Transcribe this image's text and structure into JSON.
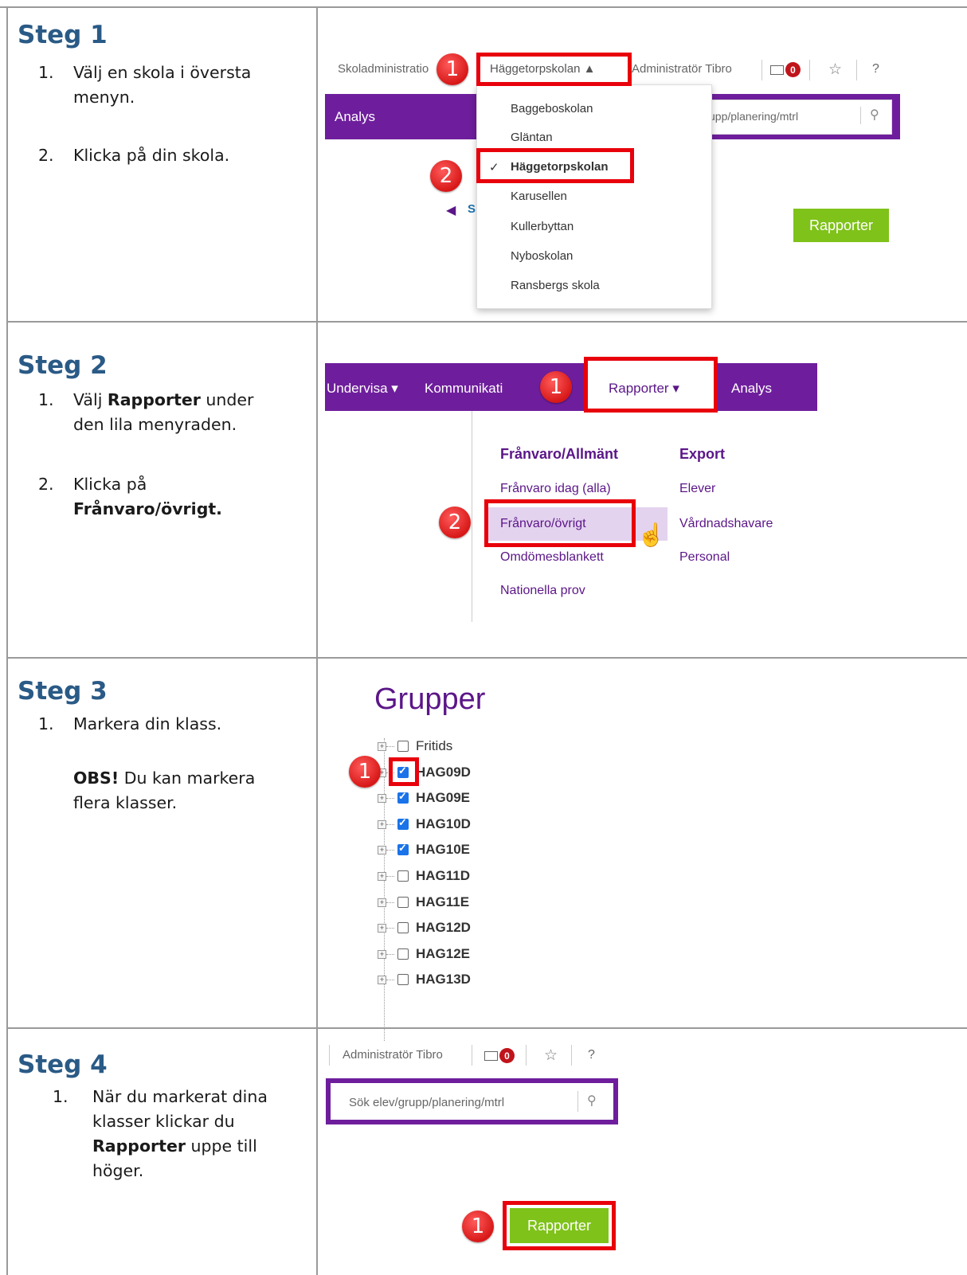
{
  "steps": [
    {
      "title": "Steg 1",
      "items": [
        {
          "n": "1.",
          "text": "Välj en skola i översta menyn."
        },
        {
          "n": "2.",
          "text": "Klicka på din skola."
        }
      ]
    },
    {
      "title": "Steg 2",
      "items": [
        {
          "n": "1.",
          "pre": "Välj ",
          "bold": "Rapporter",
          "post": " under den lila menyraden."
        },
        {
          "n": "2.",
          "pre": "Klicka på ",
          "bold": "Frånvaro/övrigt."
        }
      ]
    },
    {
      "title": "Steg 3",
      "items": [
        {
          "n": "1.",
          "text": "Markera din klass."
        }
      ],
      "note_bold": "OBS!",
      "note_text": " Du kan markera flera klasser."
    },
    {
      "title": "Steg 4",
      "items": [
        {
          "n": "1.",
          "pre": "När du markerat dina klasser klickar du ",
          "bold": "Rapporter",
          "post": " uppe till höger."
        }
      ]
    }
  ],
  "shot1": {
    "app_name": "Skoladministratio",
    "school_selector": "Häggetorpskolan ▲",
    "user": "Administratör Tibro",
    "mail_count": "0",
    "star": "☆",
    "help": "?",
    "nav_item": "Analys",
    "search_placeholder": "upp/planering/mtrl",
    "schools": [
      "Baggeboskolan",
      "Gläntan",
      "Häggetorpskolan",
      "Karusellen",
      "Kullerbyttan",
      "Nyboskolan",
      "Ransbergs skola"
    ],
    "selected_check": "✓",
    "back_link": "S",
    "rapporter_button": "Rapporter",
    "badges": [
      "1",
      "2"
    ]
  },
  "shot2": {
    "menu": [
      "Undervisa ▾",
      "Kommunikati",
      "Rapporter ▾",
      "Analys"
    ],
    "col1_header": "Frånvaro/Allmänt",
    "col1": [
      "Frånvaro idag (alla)",
      "Frånvaro/övrigt",
      "Omdömesblankett",
      "Nationella prov"
    ],
    "col2_header": "Export",
    "col2": [
      "Elever",
      "Vårdnadshavare",
      "Personal"
    ],
    "badges": [
      "1",
      "2"
    ]
  },
  "shot3": {
    "heading": "Grupper",
    "groups": [
      {
        "name": "Fritids",
        "checked": false
      },
      {
        "name": "HAG09D",
        "checked": true
      },
      {
        "name": "HAG09E",
        "checked": true
      },
      {
        "name": "HAG10D",
        "checked": true
      },
      {
        "name": "HAG10E",
        "checked": true
      },
      {
        "name": "HAG11D",
        "checked": false
      },
      {
        "name": "HAG11E",
        "checked": false
      },
      {
        "name": "HAG12D",
        "checked": false
      },
      {
        "name": "HAG12E",
        "checked": false
      },
      {
        "name": "HAG13D",
        "checked": false
      }
    ],
    "badge": "1"
  },
  "shot4": {
    "user": "Administratör Tibro",
    "mail_count": "0",
    "star": "☆",
    "help": "?",
    "search_placeholder": "Sök elev/grupp/planering/mtrl",
    "rapporter_button": "Rapporter",
    "badge": "1"
  },
  "colors": {
    "purple": "#6e1e9c",
    "green": "#7fc21a",
    "red": "#e8000b",
    "title_blue": "#2a5a86"
  }
}
